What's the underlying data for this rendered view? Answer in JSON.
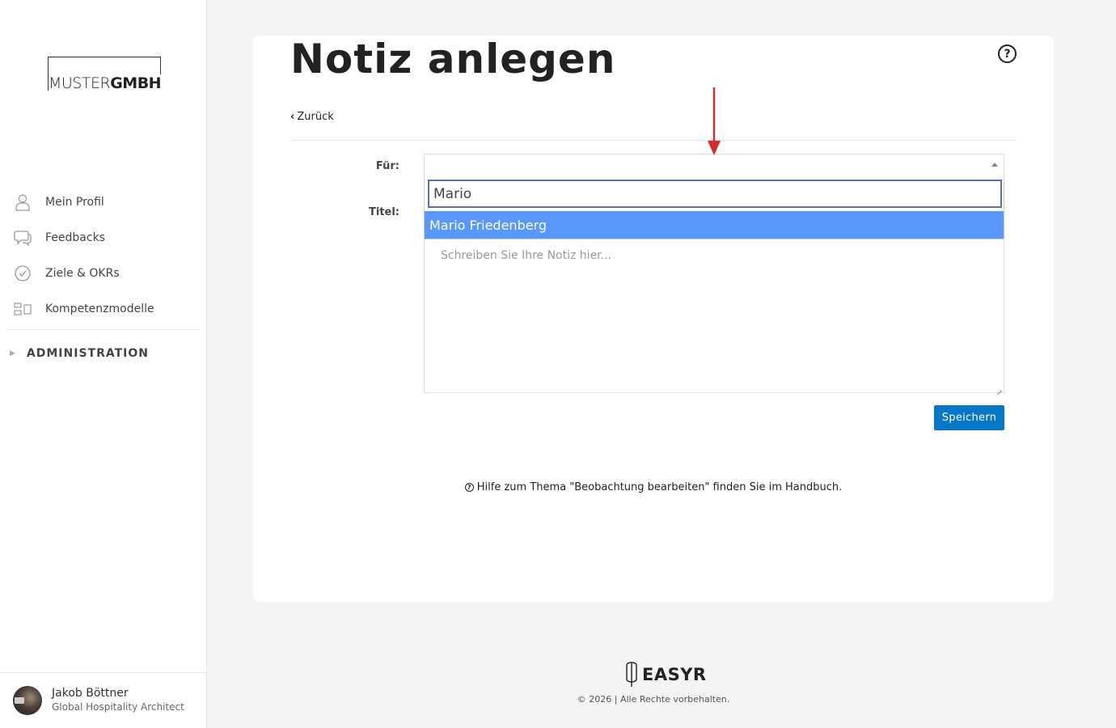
{
  "sidebar": {
    "logo": {
      "light": "MUSTER",
      "bold": "GMBH"
    },
    "items": [
      {
        "label": "Mein Profil",
        "icon": "user-icon"
      },
      {
        "label": "Feedbacks",
        "icon": "chat-icon"
      },
      {
        "label": "Ziele & OKRs",
        "icon": "check-circle-icon"
      },
      {
        "label": "Kompetenzmodelle",
        "icon": "model-icon"
      }
    ],
    "admin_label": "ADMINISTRATION",
    "user": {
      "name": "Jakob Böttner",
      "role": "Global Hospitality Architect"
    }
  },
  "main": {
    "title": "Notiz anlegen",
    "help_icon": "question-circle-icon",
    "back_label": "Zurück",
    "form": {
      "fuer_label": "Für:",
      "titel_label": "Titel:",
      "search_value": "Mario",
      "option_highlighted": "Mario Friedenberg",
      "textarea_placeholder": "Schreiben Sie Ihre Notiz hier...",
      "save_label": "Speichern"
    },
    "hint": "Hilfe zum Thema \"Beobachtung bearbeiten\" finden Sie im Handbuch."
  },
  "footer": {
    "brand": "EASYR",
    "copyright": "© 2026 | Alle Rechte vorbehalten."
  },
  "colors": {
    "accent": "#0677c7",
    "highlight": "#5897fb",
    "annotation": "#d42a2a"
  }
}
